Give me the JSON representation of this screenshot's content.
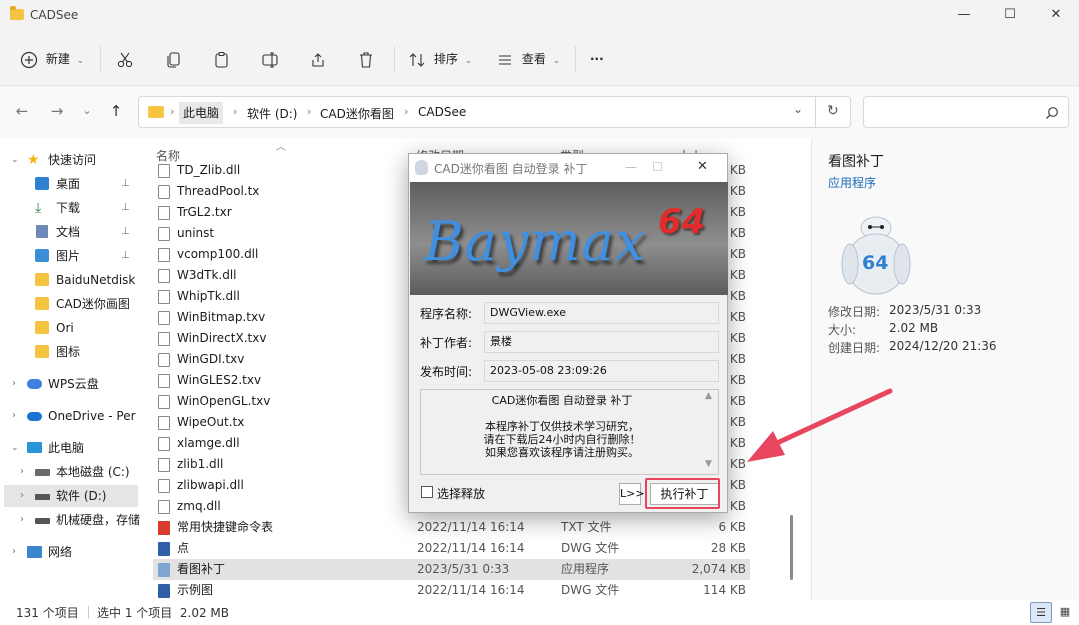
{
  "window": {
    "title": "CADSee",
    "minimize_glyph": "—",
    "maximize_glyph": "☐",
    "close_glyph": "✕"
  },
  "toolbar": {
    "new_label": "新建",
    "sort_label": "排序",
    "view_label": "查看",
    "more_glyph": "···",
    "icons": [
      "add-icon",
      "cut-icon",
      "copy-icon",
      "paste-icon",
      "rename-icon",
      "share-icon",
      "delete-icon",
      "sort-icon",
      "view-icon"
    ]
  },
  "navigation": {
    "back_glyph": "←",
    "forward_glyph": "→",
    "recent_glyph": "⌄",
    "up_glyph": "↑",
    "breadcrumb": [
      "此电脑",
      "软件 (D:)",
      "CAD迷你看图",
      "CADSee"
    ],
    "crumb_sep_glyph": "›",
    "dropdown_glyph": "⌄",
    "refresh_glyph": "↻",
    "search_placeholder": ""
  },
  "sidebar": {
    "items": [
      {
        "label": "快速访问",
        "icon": "star-icon",
        "pinned": false
      },
      {
        "label": "桌面",
        "icon": "desktop-icon",
        "pinned": true
      },
      {
        "label": "下载",
        "icon": "download-icon",
        "pinned": true
      },
      {
        "label": "文档",
        "icon": "documents-icon",
        "pinned": true
      },
      {
        "label": "图片",
        "icon": "pictures-icon",
        "pinned": true
      },
      {
        "label": "BaiduNetdisk",
        "icon": "folder-icon",
        "pinned": false
      },
      {
        "label": "CAD迷你画图",
        "icon": "folder-icon",
        "pinned": false
      },
      {
        "label": "Ori",
        "icon": "folder-icon",
        "pinned": false
      },
      {
        "label": "图标",
        "icon": "folder-icon",
        "pinned": false
      },
      {
        "label": "WPS云盘",
        "icon": "cloud-icon",
        "pinned": false
      },
      {
        "label": "OneDrive - Per",
        "icon": "onedrive-icon",
        "pinned": false
      },
      {
        "label": "此电脑",
        "icon": "pc-icon",
        "pinned": false
      },
      {
        "label": "本地磁盘 (C:)",
        "icon": "windows-drive-icon",
        "pinned": false
      },
      {
        "label": "软件 (D:)",
        "icon": "drive-icon",
        "pinned": false,
        "selected": true
      },
      {
        "label": "机械硬盘，存储",
        "icon": "drive-icon",
        "pinned": false
      },
      {
        "label": "网络",
        "icon": "network-icon",
        "pinned": false
      }
    ],
    "pin_glyph": "📌"
  },
  "filelist": {
    "columns": {
      "name": "名称",
      "date": "修改日期",
      "type": "类型",
      "size": "大小"
    },
    "rows": [
      {
        "name": "TD_Zlib.dll",
        "date": "",
        "type": "",
        "size": "KB"
      },
      {
        "name": "ThreadPool.tx",
        "date": "",
        "type": "",
        "size": "KB"
      },
      {
        "name": "TrGL2.txr",
        "date": "",
        "type": "",
        "size": "KB"
      },
      {
        "name": "uninst",
        "date": "",
        "type": "",
        "size": "KB"
      },
      {
        "name": "vcomp100.dll",
        "date": "",
        "type": "",
        "size": "KB"
      },
      {
        "name": "W3dTk.dll",
        "date": "",
        "type": "",
        "size": "KB"
      },
      {
        "name": "WhipTk.dll",
        "date": "",
        "type": "",
        "size": "KB"
      },
      {
        "name": "WinBitmap.txv",
        "date": "",
        "type": "",
        "size": "KB"
      },
      {
        "name": "WinDirectX.txv",
        "date": "",
        "type": "",
        "size": "KB"
      },
      {
        "name": "WinGDI.txv",
        "date": "",
        "type": "",
        "size": "KB"
      },
      {
        "name": "WinGLES2.txv",
        "date": "",
        "type": "",
        "size": "KB"
      },
      {
        "name": "WinOpenGL.txv",
        "date": "",
        "type": "",
        "size": "KB"
      },
      {
        "name": "WipeOut.tx",
        "date": "",
        "type": "",
        "size": "KB"
      },
      {
        "name": "xlamge.dll",
        "date": "",
        "type": "",
        "size": "KB"
      },
      {
        "name": "zlib1.dll",
        "date": "",
        "type": "",
        "size": "KB"
      },
      {
        "name": "zlibwapi.dll",
        "date": "",
        "type": "",
        "size": "KB"
      },
      {
        "name": "zmq.dll",
        "date": "",
        "type": "",
        "size": "KB"
      },
      {
        "name": "常用快捷键命令表",
        "date": "2022/11/14 16:14",
        "type": "TXT 文件",
        "size": "6 KB"
      },
      {
        "name": "点",
        "date": "2022/11/14 16:14",
        "type": "DWG 文件",
        "size": "28 KB"
      },
      {
        "name": "看图补丁",
        "date": "2023/5/31 0:33",
        "type": "应用程序",
        "size": "2,074 KB",
        "selected": true
      },
      {
        "name": "示例图",
        "date": "2022/11/14 16:14",
        "type": "DWG 文件",
        "size": "114 KB"
      }
    ]
  },
  "details": {
    "title": "看图补丁",
    "subtitle": "应用程序",
    "icon": "baymax-icon",
    "icon_text": "64",
    "fields": [
      {
        "label": "修改日期:",
        "value": "2023/5/31 0:33"
      },
      {
        "label": "大小:",
        "value": "2.02 MB"
      },
      {
        "label": "创建日期:",
        "value": "2024/12/20 21:36"
      }
    ]
  },
  "status": {
    "count": "131 个项目",
    "selection": "选中 1 个项目  2.02 MB"
  },
  "dialog": {
    "title": "CAD迷你看图 自动登录 补丁",
    "close_glyph": "✕",
    "banner_text": "Baymax",
    "banner_badge": "64",
    "program_label": "程序名称:",
    "program_value": "DWGView.exe",
    "author_label": "补丁作者:",
    "author_value": "景楼",
    "date_label": "发布时间:",
    "date_value": "2023-05-08 23:09:26",
    "memo_lines": [
      "CAD迷你看图 自动登录 补丁",
      "本程序补丁仅供技术学习研究，",
      "请在下载后24小时内自行删除！",
      "如果您喜欢该程序请注册购买。"
    ],
    "scroll_up_glyph": "▲",
    "scroll_down_glyph": "▼",
    "checkbox_label": "选择释放",
    "log_button": "L>>",
    "run_button": "执行补丁"
  },
  "colors": {
    "accent": "#1a6bb8",
    "highlight": "#e8465f",
    "selection": "#e2e2e2"
  }
}
